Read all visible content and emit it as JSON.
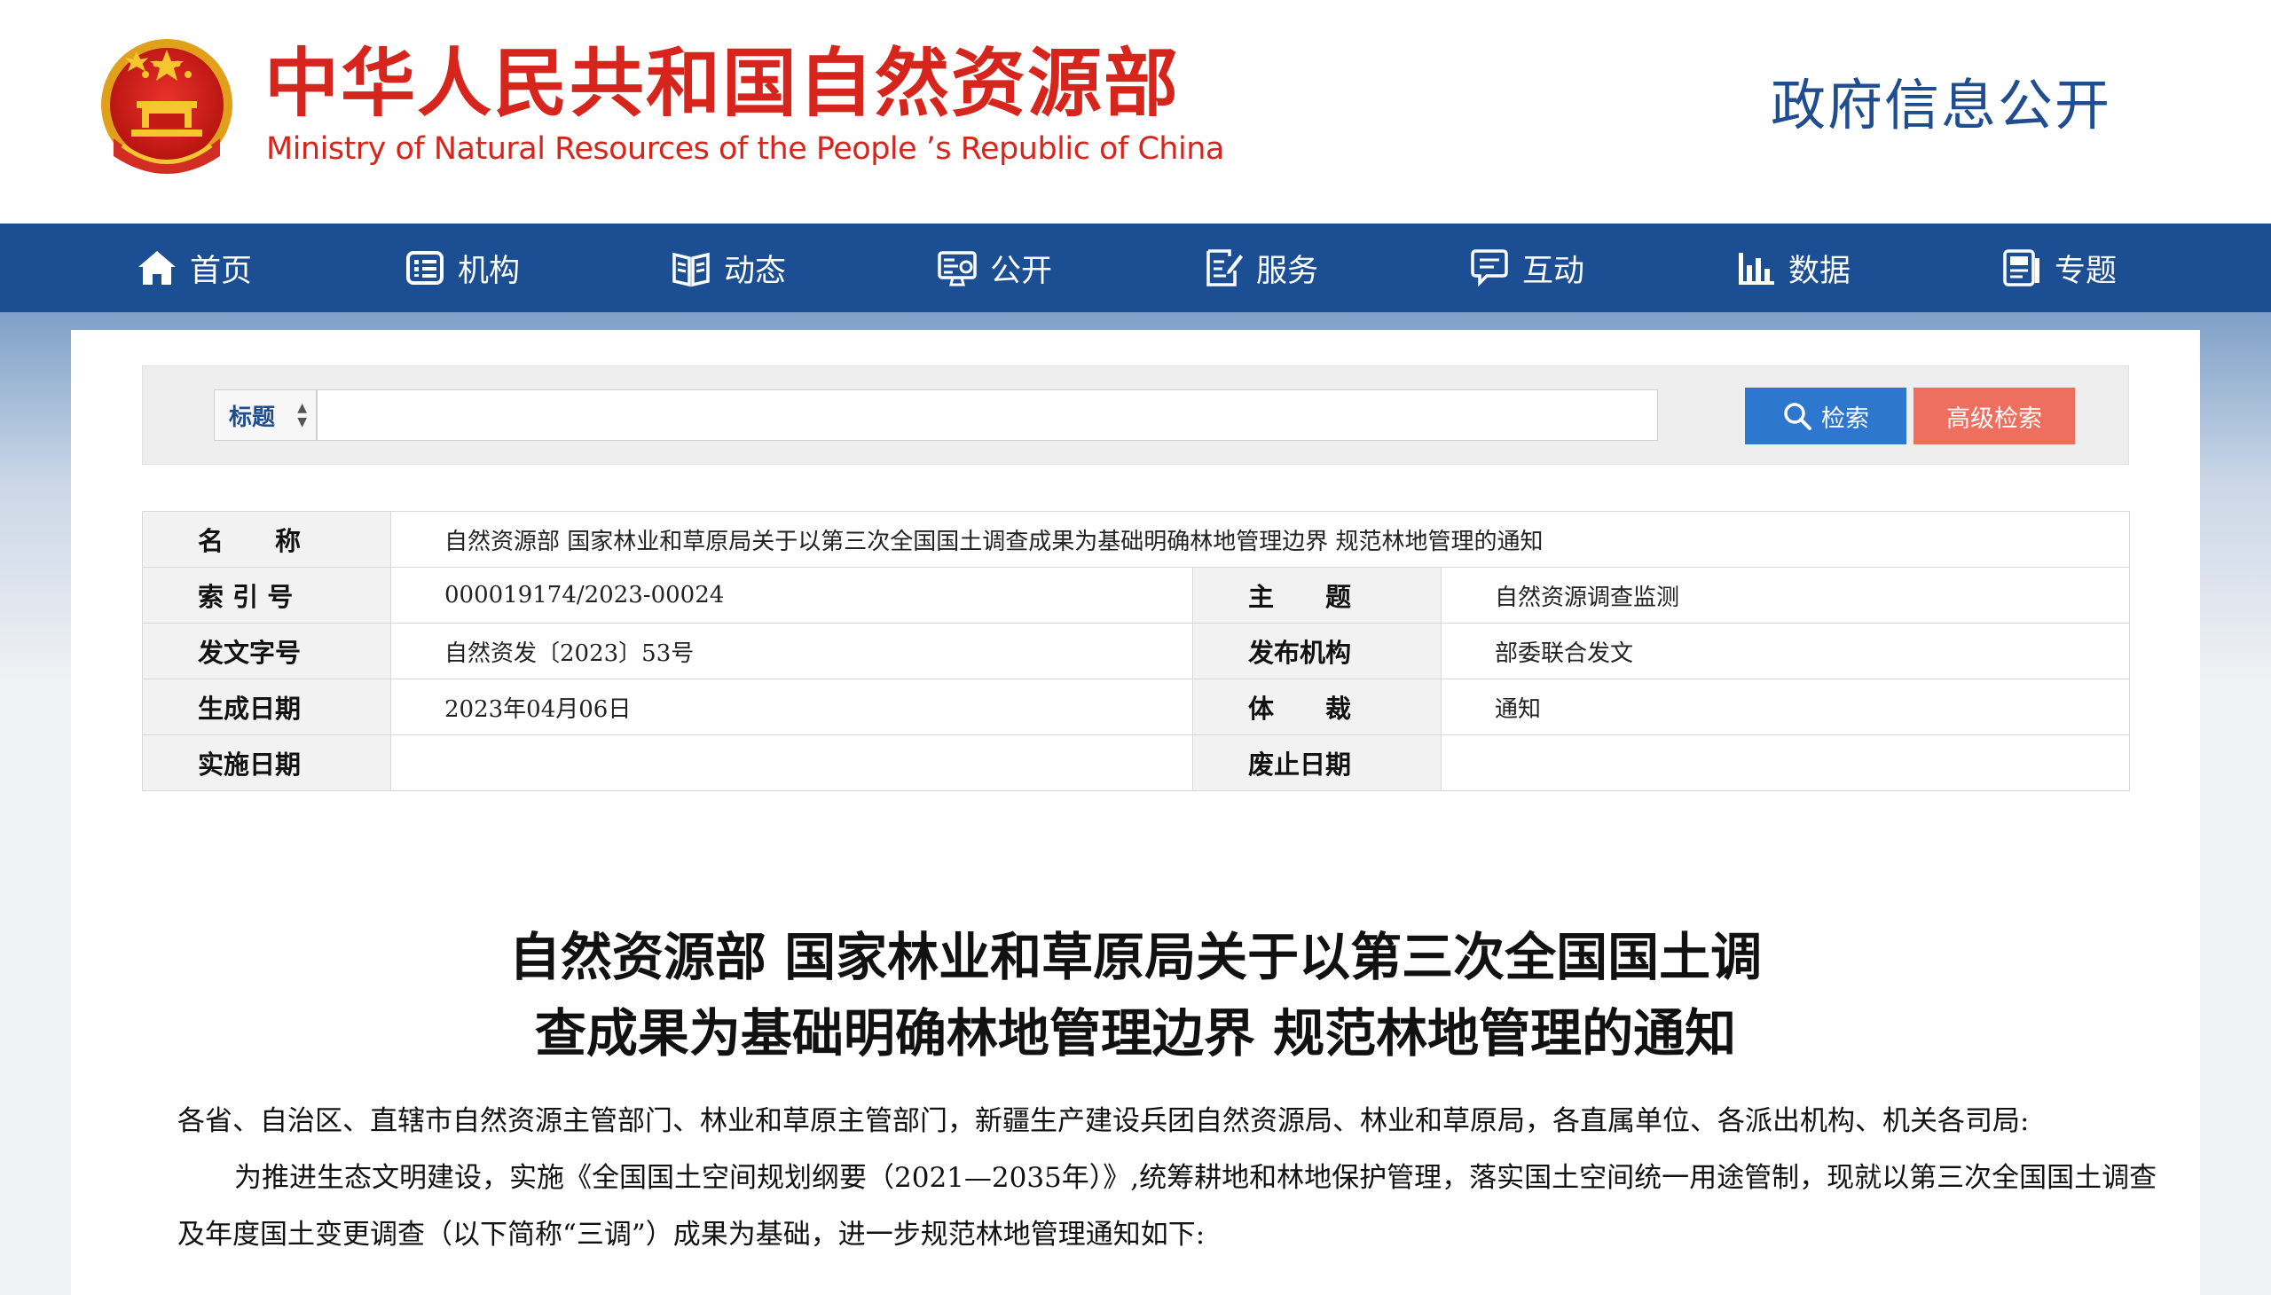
{
  "header": {
    "site_name_cn": "中华人民共和国自然资源部",
    "site_name_en": "Ministry of Natural Resources of the People ’s Republic of China",
    "section_title": "政府信息公开"
  },
  "nav": {
    "items": [
      {
        "label": "首页",
        "icon": "home-icon"
      },
      {
        "label": "机构",
        "icon": "organization-icon"
      },
      {
        "label": "动态",
        "icon": "news-book-icon"
      },
      {
        "label": "公开",
        "icon": "monitor-icon"
      },
      {
        "label": "服务",
        "icon": "service-doc-icon"
      },
      {
        "label": "互动",
        "icon": "chat-icon"
      },
      {
        "label": "数据",
        "icon": "bar-chart-icon"
      },
      {
        "label": "专题",
        "icon": "topic-icon"
      }
    ]
  },
  "search": {
    "field_selected": "标题",
    "input_value": "",
    "search_label": "检索",
    "advanced_label": "高级检索"
  },
  "info": {
    "name_label": "名　　称",
    "name_value": "自然资源部 国家林业和草原局关于以第三次全国国土调查成果为基础明确林地管理边界 规范林地管理的通知",
    "index_label": "索 引 号",
    "index_value": "000019174/2023-00024",
    "subject_label": "主　　题",
    "subject_value": "自然资源调查监测",
    "docno_label": "发文字号",
    "docno_value": "自然资发〔2023〕53号",
    "issuer_label": "发布机构",
    "issuer_value": "部委联合发文",
    "date_label": "生成日期",
    "date_value": "2023年04月06日",
    "genre_label": "体　　裁",
    "genre_value": "通知",
    "effective_label": "实施日期",
    "effective_value": "",
    "abolish_label": "废止日期",
    "abolish_value": ""
  },
  "article": {
    "title_line1": "自然资源部 国家林业和草原局关于以第三次全国国土调",
    "title_line2": "查成果为基础明确林地管理边界 规范林地管理的通知",
    "addressee": "各省、自治区、直辖市自然资源主管部门、林业和草原主管部门，新疆生产建设兵团自然资源局、林业和草原局，各直属单位、各派出机构、机关各司局:",
    "para1": "为推进生态文明建设，实施《全国国土空间规划纲要（2021—2035年）》,统筹耕地和林地保护管理，落实国土空间统一用途管制，现就以第三次全国国土调查及年度国土变更调查（以下简称“三调”）成果为基础，进一步规范林地管理通知如下:"
  },
  "colors": {
    "brand_red": "#d6251c",
    "nav_blue": "#1c4e93",
    "search_blue": "#2e77cf",
    "advanced_red": "#ee6f5d"
  }
}
